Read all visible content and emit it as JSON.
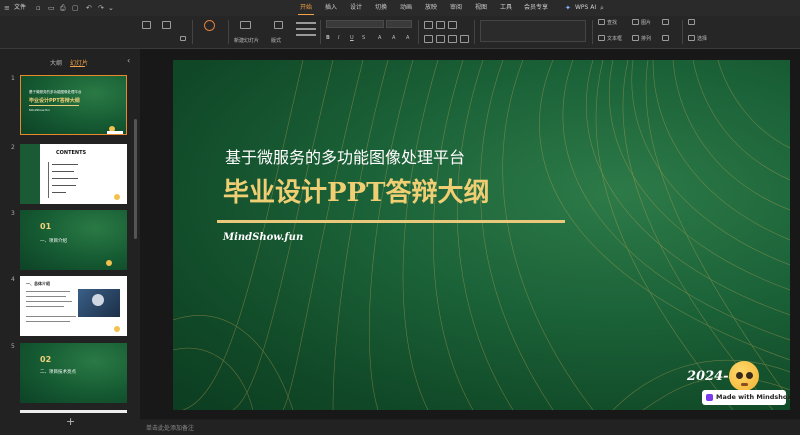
{
  "menubar": {
    "file_label": "文件",
    "tabs": [
      {
        "label": "开始",
        "active": true
      },
      {
        "label": "插入"
      },
      {
        "label": "设计"
      },
      {
        "label": "切换"
      },
      {
        "label": "动画"
      },
      {
        "label": "放映"
      },
      {
        "label": "审阅"
      },
      {
        "label": "视图"
      },
      {
        "label": "工具"
      },
      {
        "label": "会员专享"
      },
      {
        "label": "WPS AI"
      }
    ]
  },
  "ribbon": {
    "new_slide": "新建幻灯片",
    "layout": "版式",
    "find": "查找",
    "textbox": "文本框",
    "arrange": "排列",
    "picture": "图片",
    "select": "选择"
  },
  "left_panel": {
    "tabs": [
      {
        "label": "大纲"
      },
      {
        "label": "幻灯片",
        "active": true
      }
    ],
    "slides": [
      {
        "num": "1",
        "line1": "基于微服务的多功能图像处理平台",
        "line2": "毕业设计PPT答辩大纲",
        "line3": "MindShow.fun"
      },
      {
        "num": "2",
        "title": "CONTENTS"
      },
      {
        "num": "3",
        "big": "01",
        "title": "一、项目介绍"
      },
      {
        "num": "4",
        "title": "一、总体介绍"
      },
      {
        "num": "5",
        "big": "02",
        "title": "二、项目技术亮点"
      }
    ],
    "add_label": "+"
  },
  "slide": {
    "subtitle": "基于微服务的多功能图像处理平台",
    "title": "毕业设计PPT答辩大纲",
    "author": "MindShow.fun",
    "date": "2024-0",
    "badge": "Made with Mindshow"
  },
  "status": {
    "notes_hint": "单击此处添加备注"
  },
  "colors": {
    "accent": "#f0a24a",
    "gold": "#e8c87a",
    "slide_green": "#155a32"
  }
}
